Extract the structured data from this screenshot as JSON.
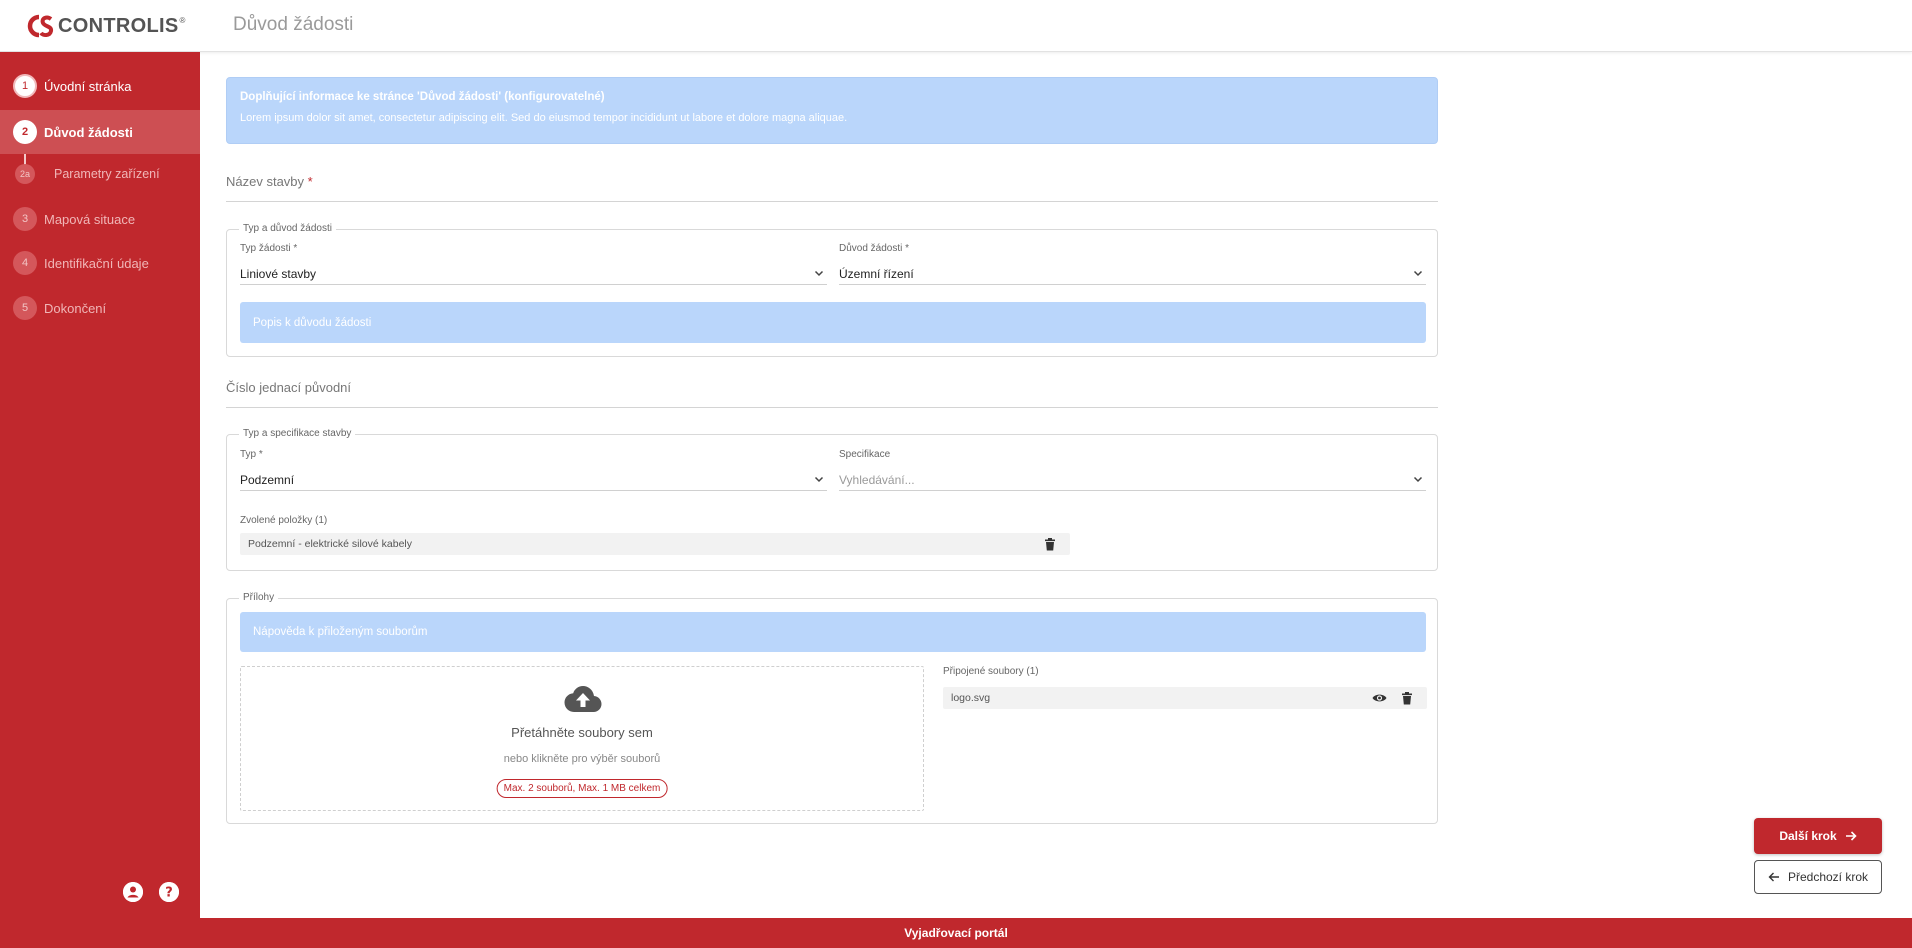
{
  "header": {
    "brand": "CONTROLIS",
    "brand_mark": "®",
    "page_title": "Důvod žádosti"
  },
  "sidebar": {
    "steps": [
      {
        "num": "1",
        "label": "Úvodní stránka",
        "state": "done"
      },
      {
        "num": "2",
        "label": "Důvod žádosti",
        "state": "active"
      },
      {
        "num": "2a",
        "label": "Parametry zařízení",
        "state": "pending"
      },
      {
        "num": "3",
        "label": "Mapová situace",
        "state": "pending"
      },
      {
        "num": "4",
        "label": "Identifikační údaje",
        "state": "pending"
      },
      {
        "num": "5",
        "label": "Dokončení",
        "state": "pending"
      }
    ],
    "bottom_icons": [
      "user-circle-icon",
      "help-circle-icon"
    ]
  },
  "info_banner": {
    "title": "Doplňující informace ke stránce 'Důvod žádosti' (konfigurovatelné)",
    "body": "Lorem ipsum dolor sit amet, consectetur adipiscing elit. Sed do eiusmod tempor incididunt ut labore et dolore magna aliquae."
  },
  "fields": {
    "nazev_stavby": {
      "label": "Název stavby",
      "required_mark": "*"
    },
    "cislo_jednaci": {
      "label": "Číslo jednací původní"
    }
  },
  "typ_duvod": {
    "legend": "Typ a důvod žádosti",
    "typ": {
      "label": "Typ žádosti *",
      "value": "Liniové stavby"
    },
    "duvod": {
      "label": "Důvod žádosti *",
      "value": "Územní řízení"
    },
    "popis_placeholder": "Popis k důvodu žádosti"
  },
  "typ_spec": {
    "legend": "Typ a specifikace stavby",
    "typ": {
      "label": "Typ *",
      "value": "Podzemní"
    },
    "spec": {
      "label": "Specifikace",
      "placeholder": "Vyhledávání..."
    },
    "selected_label": "Zvolené položky (1)",
    "selected_items": [
      "Podzemní - elektrické silové kabely"
    ]
  },
  "prilohy": {
    "legend": "Přílohy",
    "hint": "Nápověda k přiloženým souborům",
    "dropzone_title": "Přetáhněte soubory sem",
    "dropzone_sub": "nebo klikněte pro výběr souborů",
    "limit": "Max. 2 souborů, Max. 1 MB celkem",
    "attached_label": "Připojené soubory (1)",
    "files": [
      "logo.svg"
    ]
  },
  "nav": {
    "next": "Další krok",
    "prev": "Předchozí krok"
  },
  "footer": {
    "text": "Vyjadřovací portál"
  },
  "colors": {
    "brand_red": "#c0282d",
    "info_blue": "#bad6fb"
  }
}
